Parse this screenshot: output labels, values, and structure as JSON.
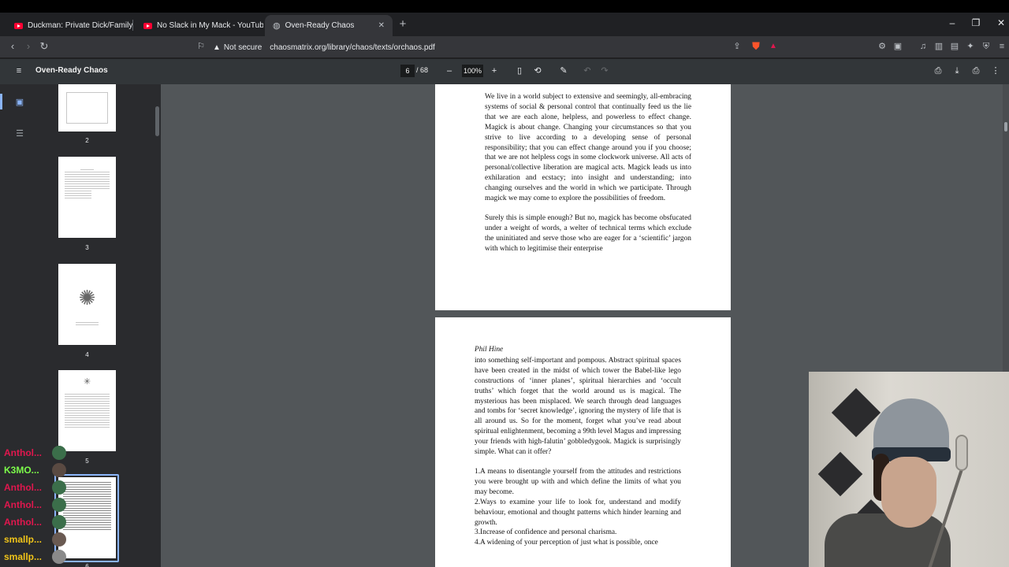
{
  "browser": {
    "tabs": [
      {
        "title": "Duckman: Private Dick/Family Man -",
        "icon": "youtube-icon"
      },
      {
        "title": "No Slack in My Mack - YouTube",
        "icon": "youtube-icon"
      },
      {
        "title": "Oven-Ready Chaos",
        "icon": "globe-icon",
        "active": true
      }
    ],
    "security_label": "Not secure",
    "url": "chaosmatrix.org/library/chaos/texts/orchaos.pdf"
  },
  "pdf": {
    "title": "Oven-Ready Chaos",
    "current_page": "6",
    "total_pages": "/ 68",
    "zoom": "100%",
    "thumbnails": [
      {
        "number": "2"
      },
      {
        "number": "3"
      },
      {
        "number": "4"
      },
      {
        "number": "5"
      },
      {
        "number": "6",
        "selected": true
      }
    ],
    "page_a": {
      "paragraph_1": "We live in a world subject to extensive and seemingly, all-embracing systems of social & personal control that continually feed us the lie that we are each alone, helpless, and powerless to effect change. Magick is about change. Changing your circumstances so that you strive to live according to a developing sense of personal responsibility; that you can effect change around you if you choose; that we are not helpless cogs in some clockwork universe. All acts of personal/collective liberation are magical acts. Magick leads us into exhilaration and ecstacy; into insight and understanding; into changing ourselves and the world in which we participate. Through magick we may come to explore the possibilities of freedom.",
      "paragraph_2": "Surely this is simple enough? But no, magick has become obsfucated under a weight of words, a welter of technical terms which exclude the uninitiated and serve those who are eager for a ‘scientific’ jargon with which to legitimise their enterprise"
    },
    "page_b": {
      "author": "Phil Hine",
      "paragraph_1": "into something self-important and pompous. Abstract spiritual spaces have been created in the midst of which tower the Babel-like lego constructions of ‘inner planes’, spiritual hierarchies and ‘occult truths’ which forget that the world around us is magical. The mysterious has been misplaced. We search through dead languages and tombs for ‘secret knowledge’, ignoring the mystery of life that is all around us. So for the moment, forget what you’ve read about spiritual enlightenment, becoming a 99th level Magus and impressing your friends with high-falutin’ gobbledygook. Magick is surprisingly simple. What can it offer?",
      "list": [
        "1.A means to disentangle yourself from the attitudes and restrictions you were brought up with and which define the limits of what you may become.",
        "2.Ways to examine your life to look for, understand and modify behaviour, emotional and thought patterns which hinder learning and growth.",
        "3.Increase of confidence and personal charisma.",
        "4.A widening of your perception of just what is possible, once"
      ]
    }
  },
  "chat": {
    "messages": [
      {
        "name": "Anthol...",
        "color": "#e0174e"
      },
      {
        "name": "K3MO...",
        "color": "#7cfc4a"
      },
      {
        "name": "Anthol...",
        "color": "#e0174e"
      },
      {
        "name": "Anthol...",
        "color": "#e0174e"
      },
      {
        "name": "Anthol...",
        "color": "#e0174e"
      },
      {
        "name": "smallp...",
        "color": "#f0c419"
      },
      {
        "name": "smallp...",
        "color": "#f0c419"
      }
    ]
  }
}
